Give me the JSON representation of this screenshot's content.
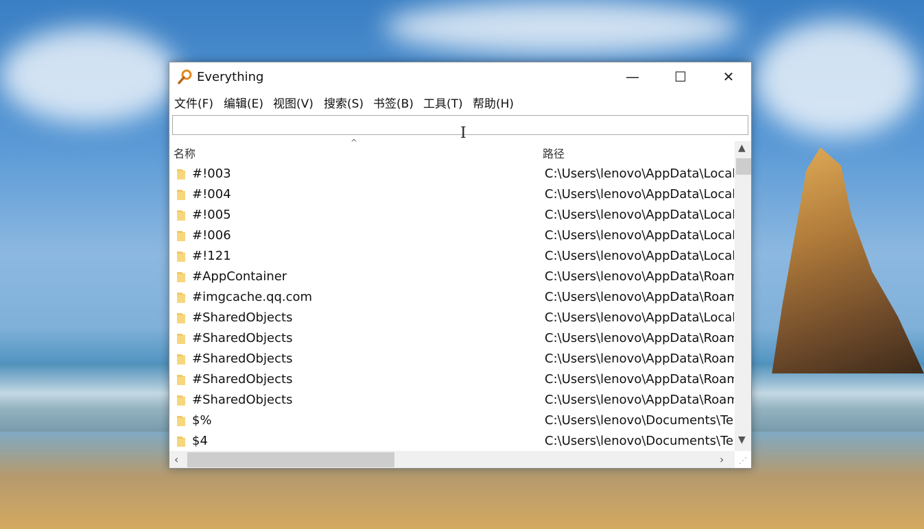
{
  "window": {
    "title": "Everything",
    "controls": {
      "minimize": "—",
      "maximize": "☐",
      "close": "✕"
    }
  },
  "menu": [
    "文件(F)",
    "编辑(E)",
    "视图(V)",
    "搜索(S)",
    "书签(B)",
    "工具(T)",
    "帮助(H)"
  ],
  "search": {
    "value": ""
  },
  "columns": {
    "name": "名称",
    "path": "路径"
  },
  "rows": [
    {
      "name": "#!003",
      "path": "C:\\Users\\lenovo\\AppData\\Local\\"
    },
    {
      "name": "#!004",
      "path": "C:\\Users\\lenovo\\AppData\\Local\\"
    },
    {
      "name": "#!005",
      "path": "C:\\Users\\lenovo\\AppData\\Local\\"
    },
    {
      "name": "#!006",
      "path": "C:\\Users\\lenovo\\AppData\\Local\\"
    },
    {
      "name": "#!121",
      "path": "C:\\Users\\lenovo\\AppData\\Local\\"
    },
    {
      "name": "#AppContainer",
      "path": "C:\\Users\\lenovo\\AppData\\Roami"
    },
    {
      "name": "#imgcache.qq.com",
      "path": "C:\\Users\\lenovo\\AppData\\Roami"
    },
    {
      "name": "#SharedObjects",
      "path": "C:\\Users\\lenovo\\AppData\\Local\\"
    },
    {
      "name": "#SharedObjects",
      "path": "C:\\Users\\lenovo\\AppData\\Roami"
    },
    {
      "name": "#SharedObjects",
      "path": "C:\\Users\\lenovo\\AppData\\Roami"
    },
    {
      "name": "#SharedObjects",
      "path": "C:\\Users\\lenovo\\AppData\\Roami"
    },
    {
      "name": "#SharedObjects",
      "path": "C:\\Users\\lenovo\\AppData\\Roami"
    },
    {
      "name": "$%",
      "path": "C:\\Users\\lenovo\\Documents\\Ten"
    },
    {
      "name": "$4",
      "path": "C:\\Users\\lenovo\\Documents\\Ten"
    }
  ],
  "colors": {
    "folder": "#f2c861",
    "scroll_thumb": "#cdcdcd",
    "title_icon": "#e08a1e"
  }
}
